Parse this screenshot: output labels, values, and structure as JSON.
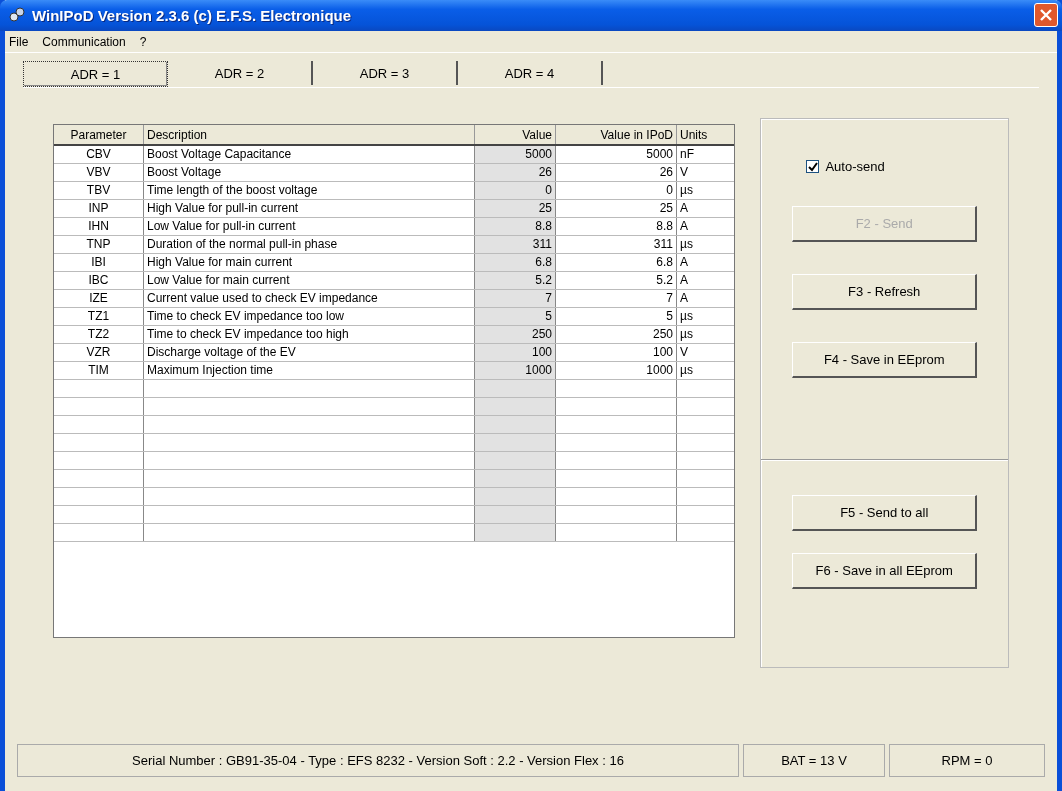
{
  "window": {
    "title": "WinIPoD Version 2.3.6 (c) E.F.S. Electronique"
  },
  "menu": [
    "File",
    "Communication",
    "?"
  ],
  "tabs": [
    {
      "label": "ADR = 1",
      "selected": true
    },
    {
      "label": "ADR = 2",
      "selected": false
    },
    {
      "label": "ADR = 3",
      "selected": false
    },
    {
      "label": "ADR = 4",
      "selected": false
    }
  ],
  "table": {
    "columns": [
      "Parameter",
      "Description",
      "Value",
      "Value in IPoD",
      "Units"
    ],
    "rows": [
      [
        "CBV",
        "Boost Voltage Capacitance",
        "5000",
        "5000",
        "nF"
      ],
      [
        "VBV",
        "Boost Voltage",
        "26",
        "26",
        "V"
      ],
      [
        "TBV",
        "Time length of the boost voltage",
        "0",
        "0",
        "µs"
      ],
      [
        "INP",
        "High Value for pull-in current",
        "25",
        "25",
        "A"
      ],
      [
        "IHN",
        "Low Value for pull-in current",
        "8.8",
        "8.8",
        "A"
      ],
      [
        "TNP",
        "Duration of the normal pull-in phase",
        "311",
        "311",
        "µs"
      ],
      [
        "IBI",
        "High Value for main current",
        "6.8",
        "6.8",
        "A"
      ],
      [
        "IBC",
        "Low Value for main current",
        "5.2",
        "5.2",
        "A"
      ],
      [
        "IZE",
        "Current value used to check EV impedance",
        "7",
        "7",
        "A"
      ],
      [
        "TZ1",
        "Time to check EV impedance too low",
        "5",
        "5",
        "µs"
      ],
      [
        "TZ2",
        "Time to check EV impedance too high",
        "250",
        "250",
        "µs"
      ],
      [
        "VZR",
        "Discharge voltage of the EV",
        "100",
        "100",
        "V"
      ],
      [
        "TIM",
        "Maximum Injection time",
        "1000",
        "1000",
        "µs"
      ]
    ]
  },
  "controls": {
    "auto_send": {
      "label": "Auto-send",
      "checked": true
    },
    "buttons": [
      {
        "label": "F2 - Send",
        "disabled": true
      },
      {
        "label": "F3 - Refresh",
        "disabled": false
      },
      {
        "label": "F4 - Save in EEprom",
        "disabled": false
      }
    ],
    "all_buttons": [
      {
        "label": "F5 - Send to all",
        "disabled": false
      },
      {
        "label": "F6 - Save in all EEprom",
        "disabled": false
      }
    ]
  },
  "status_bar": [
    "Serial Number : GB91-35-04  -  Type : EFS 8232  -  Version Soft :  2.2  -  Version Flex :  16",
    "BAT = 13 V",
    "RPM = 0"
  ]
}
